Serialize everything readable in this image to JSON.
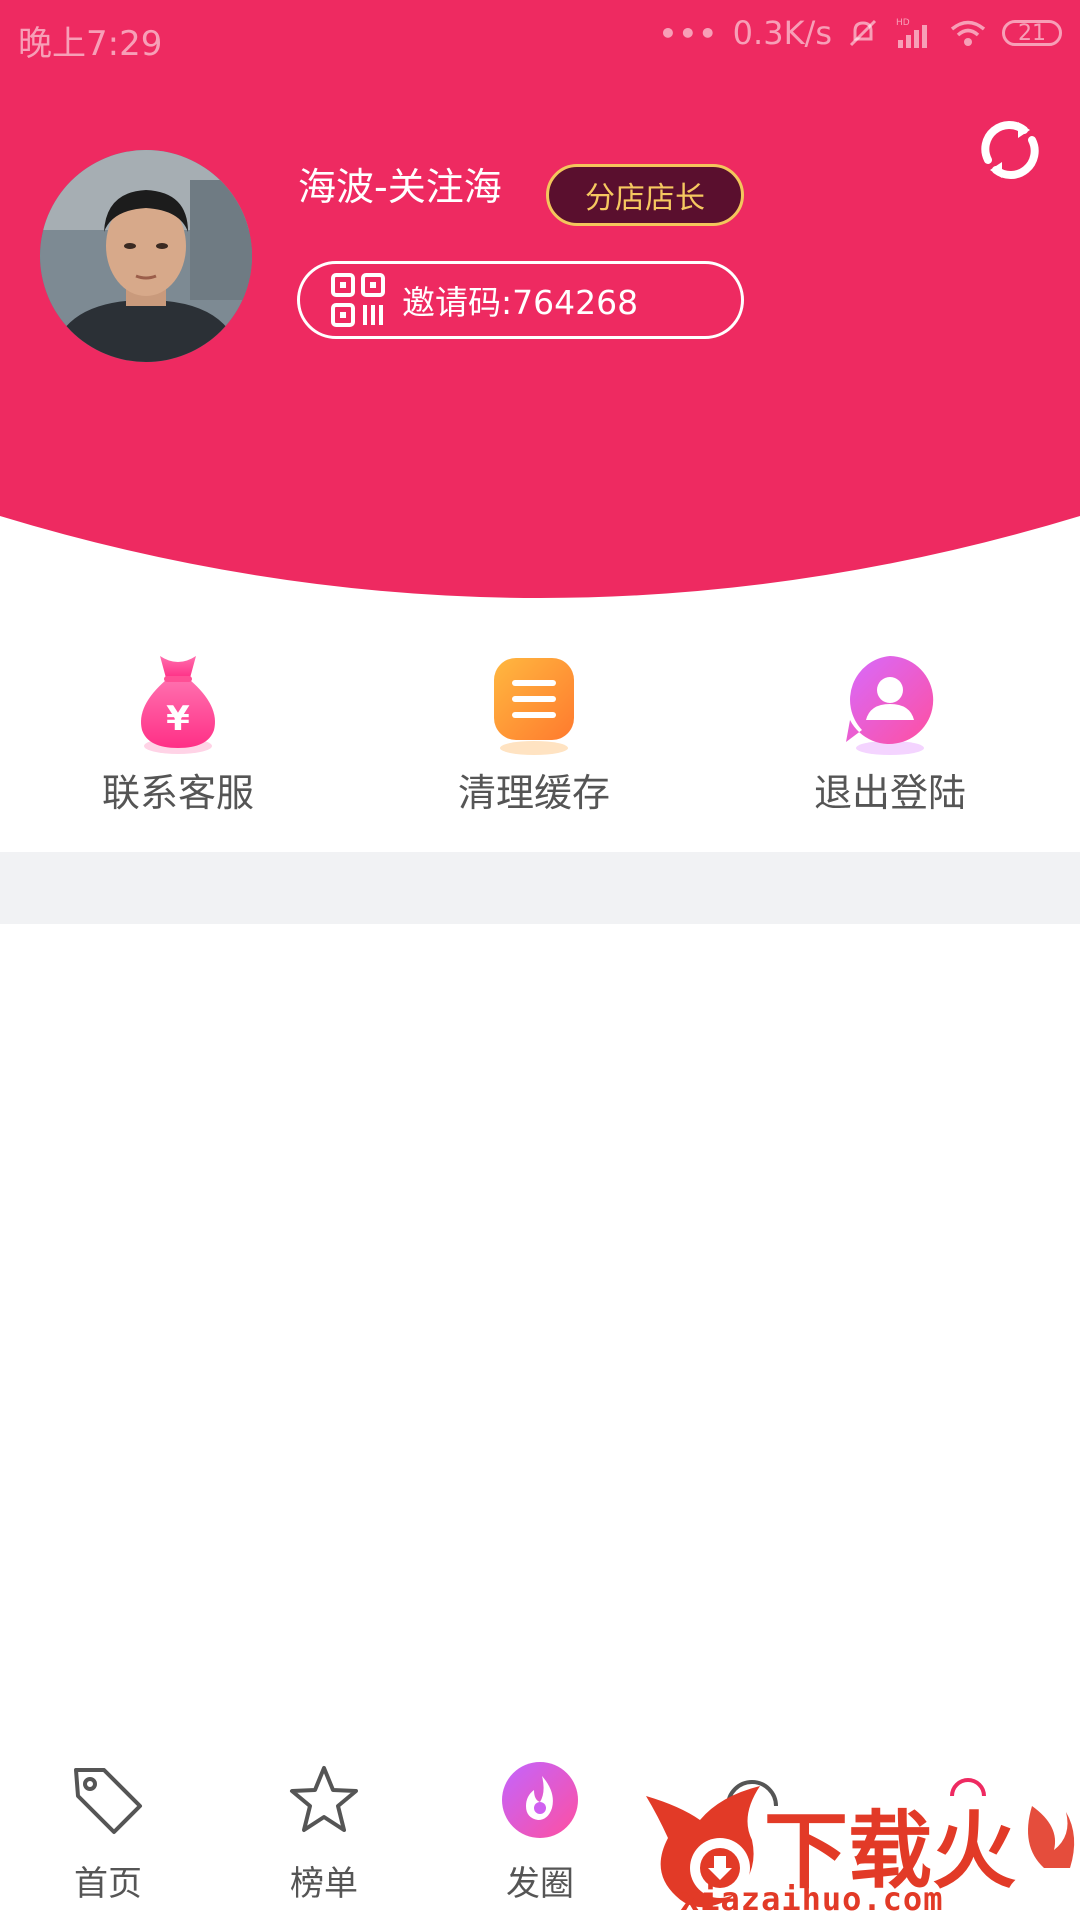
{
  "status_bar": {
    "time": "晚上7:29",
    "dots": "•••",
    "speed": "0.3K/s",
    "battery": "21"
  },
  "profile": {
    "name": "海波-关注海",
    "role": "分店店长",
    "invite_code_text": "邀请码:764268"
  },
  "actions": [
    {
      "label": "联系客服",
      "icon": "money-bag-icon"
    },
    {
      "label": "清理缓存",
      "icon": "list-icon"
    },
    {
      "label": "退出登陆",
      "icon": "user-icon"
    }
  ],
  "bottom_nav": [
    {
      "label": "首页",
      "icon": "tag-icon"
    },
    {
      "label": "榜单",
      "icon": "star-icon"
    },
    {
      "label": "发圈",
      "icon": "flame-icon"
    }
  ],
  "watermark": {
    "brand": "下载火",
    "url": "xiazaihuo.com"
  },
  "colors": {
    "header": "#ee2a61",
    "badge_bg": "#5a0f2e",
    "badge_border": "#f3c65c",
    "watermark": "#e23a27"
  }
}
